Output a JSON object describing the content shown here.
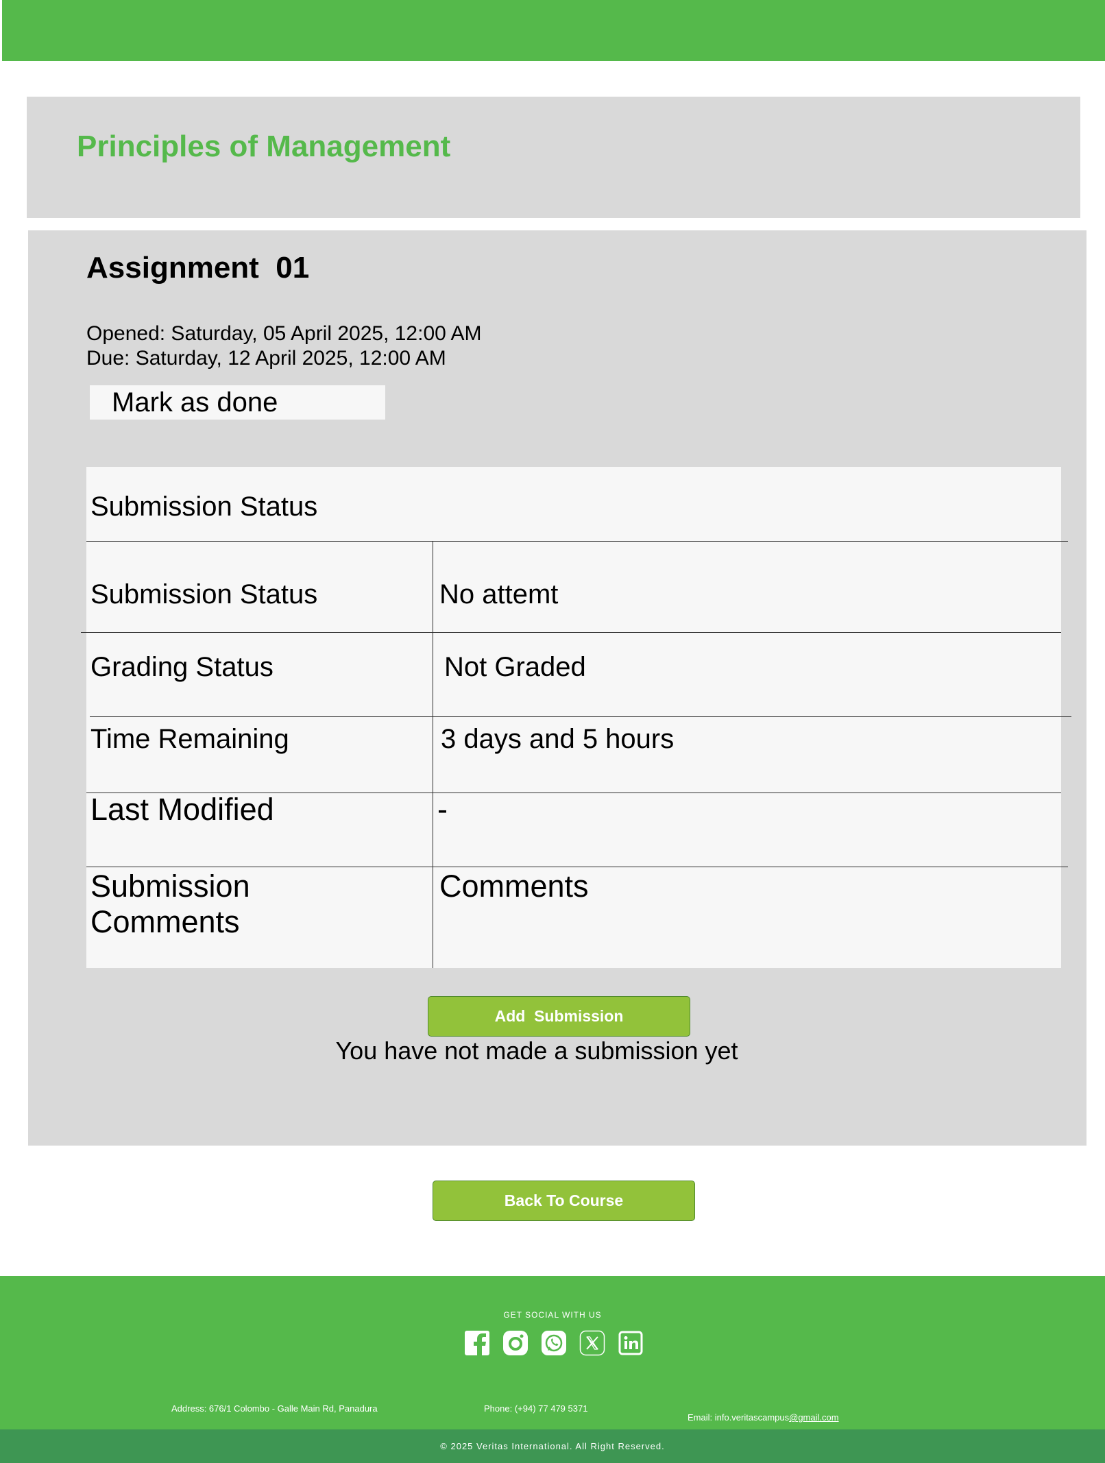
{
  "course": {
    "title": "Principles of Management"
  },
  "assignment": {
    "title": "Assignment  01",
    "opened": "Opened: Saturday, 05 April 2025, 12:00 AM",
    "due": "Due: Saturday, 12 April 2025, 12:00 AM",
    "mark_done_label": "Mark as done"
  },
  "submission_table": {
    "heading": "Submission Status",
    "rows": [
      {
        "label": "Submission Status",
        "value": "No attemt"
      },
      {
        "label": "Grading Status",
        "value": "Not Graded"
      },
      {
        "label": "Time Remaining",
        "value": "3 days and 5 hours"
      },
      {
        "label": "Last Modified",
        "value": "-"
      },
      {
        "label": "Submission Comments",
        "value": "Comments"
      }
    ]
  },
  "actions": {
    "add_submission_label": "Add  Submission",
    "no_submission_text": "You have not made a submission yet",
    "back_label": "Back To Course"
  },
  "footer": {
    "social_label": "GET SOCIAL WITH US",
    "social_icons": [
      "facebook-icon",
      "instagram-icon",
      "whatsapp-icon",
      "x-icon",
      "linkedin-icon"
    ],
    "address": "Address: 676/1 Colombo - Galle Main Rd, Panadura",
    "phone": "Phone: (+94) 77 479 5371",
    "email_prefix": "Email: info.veritascampus",
    "email_domain": "@gmail.com",
    "copyright": "© 2025 Veritas International. All Right Reserved."
  },
  "colors": {
    "brand_green": "#55b94b",
    "button_green": "#92c23a",
    "footer_dark_green": "#3e9653",
    "panel_gray": "#d9d9d9",
    "table_bg": "#f7f7f7"
  }
}
